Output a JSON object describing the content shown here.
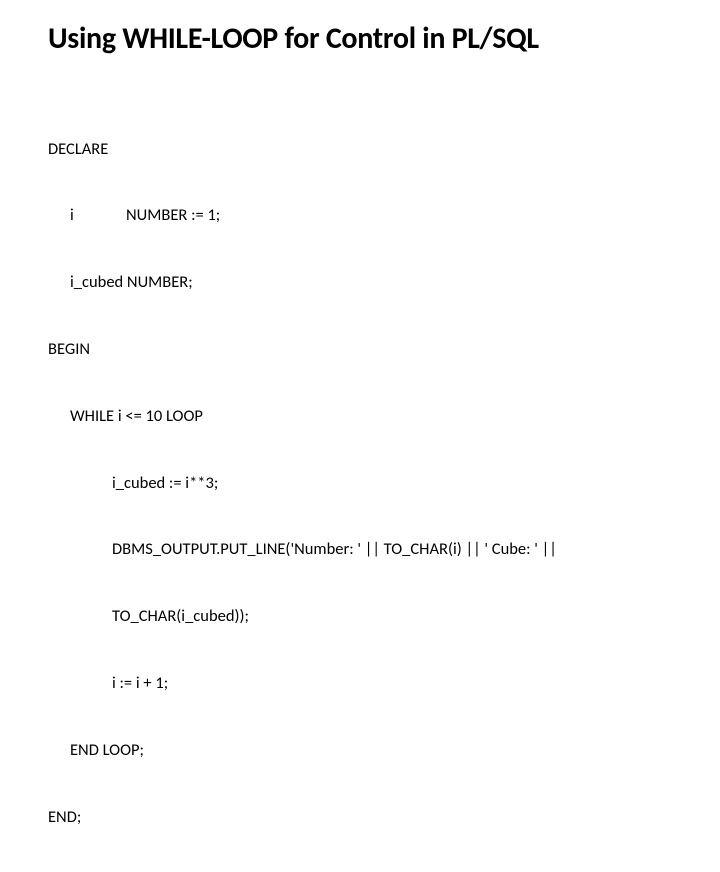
{
  "title": "Using WHILE-LOOP for Control in PL/SQL",
  "code": {
    "l1": "DECLARE",
    "l2": "i              NUMBER := 1;",
    "l3": "i_cubed NUMBER;",
    "l4": "BEGIN",
    "l5": "WHILE i <= 10 LOOP",
    "l6": "i_cubed := i**3;",
    "l7": "DBMS_OUTPUT.PUT_LINE('Number: ' || TO_CHAR(i) || ' Cube: ' ||",
    "l8": "TO_CHAR(i_cubed));",
    "l9": "i := i + 1;",
    "l10": "END LOOP;",
    "l11": "END;"
  }
}
